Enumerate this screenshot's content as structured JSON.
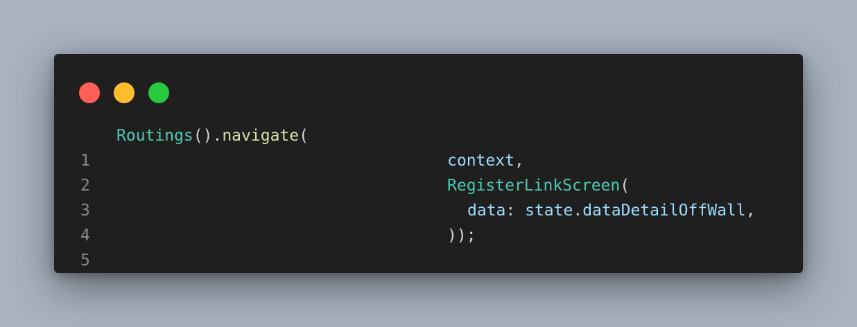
{
  "window": {
    "dots": [
      {
        "name": "close",
        "color": "#ff5f56"
      },
      {
        "name": "minimize",
        "color": "#ffbd2e"
      },
      {
        "name": "zoom",
        "color": "#27c93f"
      }
    ]
  },
  "colors": {
    "class": "#4ec9b0",
    "function": "#dcdcaa",
    "punctuation": "#d4d4d4",
    "variable": "#9cdcfe",
    "line_number": "#8a8a8a",
    "background": "#1f1f1f"
  },
  "code": {
    "line_numbers": [
      "1",
      "2",
      "3",
      "4",
      "5"
    ],
    "lines": [
      {
        "tokens": [
          {
            "text": "Routings",
            "kind": "class"
          },
          {
            "text": "().",
            "kind": "punctuation"
          },
          {
            "text": "navigate",
            "kind": "function"
          },
          {
            "text": "(",
            "kind": "punctuation"
          }
        ]
      },
      {
        "tokens": [
          {
            "text": "context",
            "kind": "variable"
          },
          {
            "text": ",",
            "kind": "punctuation"
          }
        ]
      },
      {
        "tokens": [
          {
            "text": "RegisterLinkScreen",
            "kind": "class"
          },
          {
            "text": "(",
            "kind": "punctuation"
          }
        ]
      },
      {
        "tokens": [
          {
            "text": "data",
            "kind": "variable"
          },
          {
            "text": ": ",
            "kind": "punctuation"
          },
          {
            "text": "state",
            "kind": "variable"
          },
          {
            "text": ".",
            "kind": "punctuation"
          },
          {
            "text": "dataDetailOffWall",
            "kind": "variable"
          },
          {
            "text": ",",
            "kind": "punctuation"
          }
        ]
      },
      {
        "tokens": [
          {
            "text": "));",
            "kind": "punctuation"
          }
        ]
      }
    ]
  }
}
